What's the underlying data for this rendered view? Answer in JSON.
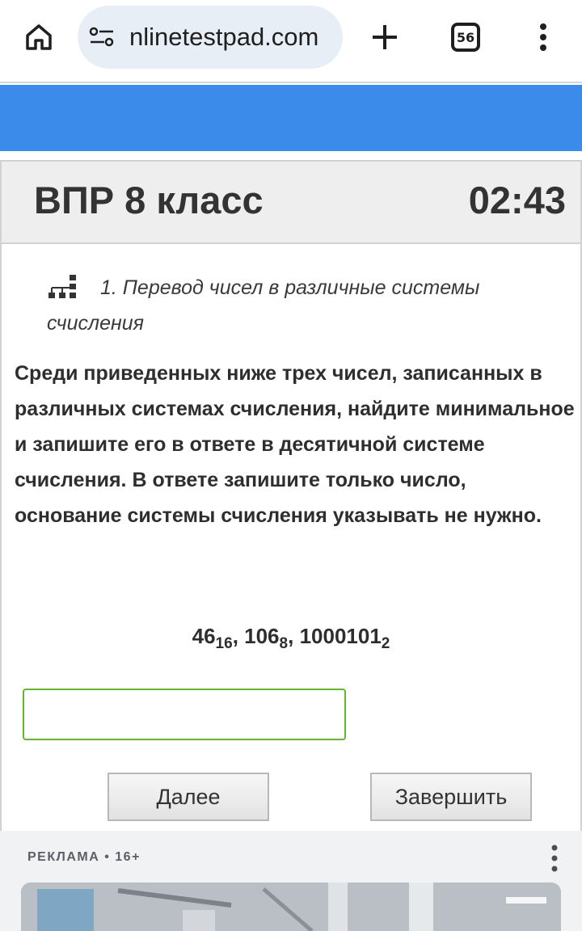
{
  "browser": {
    "url": "nlinetestpad.com",
    "tab_count": "56"
  },
  "test": {
    "title": "ВПР 8 класс",
    "timer": "02:43",
    "topic": "1. Перевод чисел в различные системы счисления",
    "question": "Среди приведенных ниже трех чисел, записанных в различных системах счисления, найдите минимальное и запишите его в ответе в десятичной системе счисления. В ответе запишите только число, основание системы счисления указывать не нужно.",
    "numbers": [
      {
        "value": "46",
        "base": "16",
        "sep": ", "
      },
      {
        "value": "106",
        "base": "8",
        "sep": ", "
      },
      {
        "value": "1000101",
        "base": "2",
        "sep": ""
      }
    ],
    "answer_value": "",
    "next_label": "Далее",
    "finish_label": "Завершить"
  },
  "ad": {
    "label": "РЕКЛАМА • 16+"
  },
  "colors": {
    "banner": "#3b8beb",
    "input_border": "#66b32e"
  }
}
